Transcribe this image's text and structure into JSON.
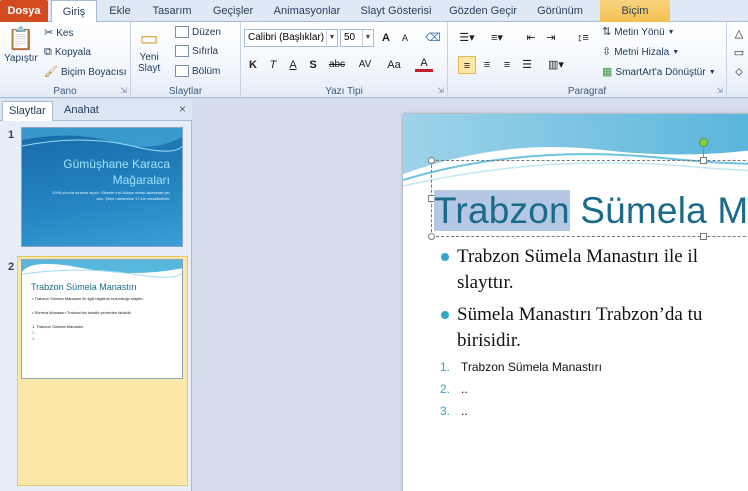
{
  "tabs": [
    "Dosya",
    "Giriş",
    "Ekle",
    "Tasarım",
    "Geçişler",
    "Animasyonlar",
    "Slayt Gösterisi",
    "Gözden Geçir",
    "Görünüm",
    "Biçim"
  ],
  "ribbon": {
    "pano": {
      "label": "Pano",
      "paste": "Yapıştır",
      "cut": "Kes",
      "copy": "Kopyala",
      "painter": "Biçim Boyacısı"
    },
    "slaytlar": {
      "label": "Slaytlar",
      "new_slide": "Yeni",
      "new_slide2": "Slayt",
      "layout": "Düzen",
      "reset": "Sıfırla",
      "section": "Bölüm"
    },
    "yazi": {
      "label": "Yazı Tipi",
      "font": "Calibri (Başlıklar)",
      "size": "50",
      "bold": "K",
      "italic": "T",
      "underline": "A",
      "shadow": "S",
      "strike": "abc",
      "spacing": "AV",
      "case": "Aa",
      "color": "A",
      "grow": "A",
      "shrink": "A"
    },
    "paragraf": {
      "label": "Paragraf",
      "direction": "Metin Yönü",
      "align_text": "Metni Hizala",
      "smartart": "SmartArt'a Dönüştür"
    }
  },
  "panel": {
    "tab_slides": "Slaytlar",
    "tab_outline": "Anahat",
    "close": "×",
    "slide1": {
      "num": "1",
      "title_line1": "Gümüşhane Karaca",
      "title_line2": "Mağaraları",
      "sub": "1996 yılında turizme açıldı. Ülkenin inci dünya mirası listesinde yer aldı. Şehir merkezine 17 km mesafededir."
    },
    "slide2": {
      "num": "2",
      "title": "Trabzon Sümela Manastırı",
      "l1": "• Trabzon Sümela Manastırı ile ilgili bilgilerin bulunduğu slayttır.",
      "l2": "• Sümela Manastırı Trabzon'da turistik yerlerden birisidir.",
      "l3": "1. Trabzon Sümela Manastırı",
      "l4": "2. ..",
      "l5": "3. .."
    }
  },
  "slide": {
    "title_hl": "Trabzon",
    "title_rest": " Sümela M",
    "bullet1a": "Trabzon Sümela Manastırı ile il",
    "bullet1b": "slayttır.",
    "bullet2a": "Sümela Manastırı Trabzon’da tu",
    "bullet2b": "birisidir.",
    "n1": "1.",
    "n1t": "Trabzon Sümela Manastırı",
    "n2": "2.",
    "n2t": "..",
    "n3": "3.",
    "n3t": ".."
  },
  "colors": {
    "file_tab": "#d44a20",
    "title": "#1a6a8a",
    "bullet": "#2ea7c8",
    "selection": "#b4c8e4"
  }
}
